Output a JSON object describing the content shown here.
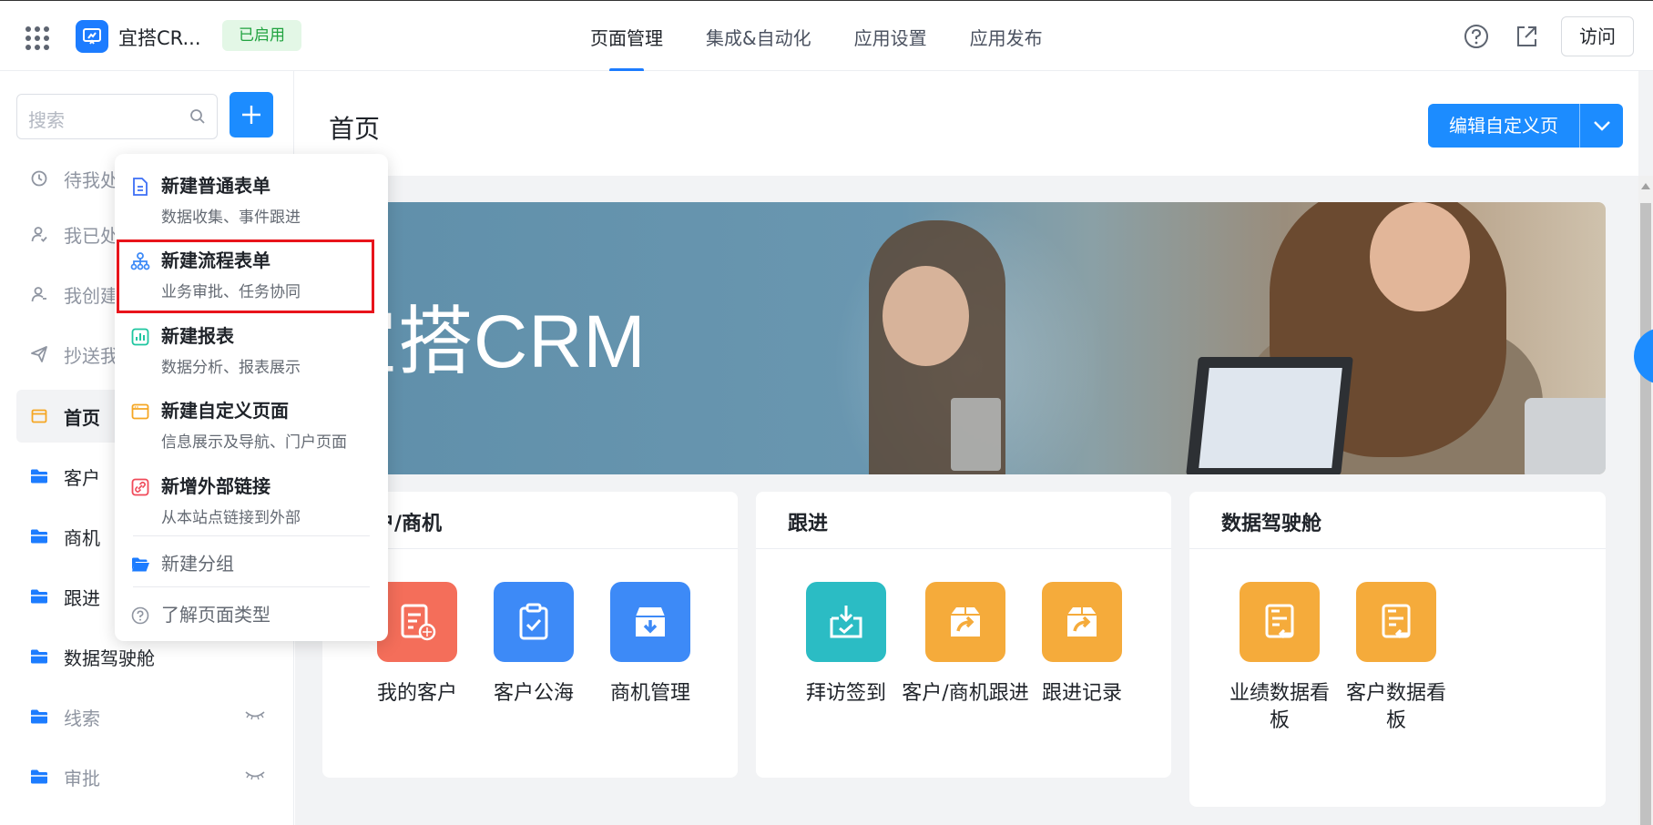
{
  "topbar": {
    "app_name": "宜搭CR...",
    "status": "已启用",
    "tabs": [
      {
        "label": "页面管理",
        "active": true
      },
      {
        "label": "集成&自动化",
        "active": false
      },
      {
        "label": "应用设置",
        "active": false
      },
      {
        "label": "应用发布",
        "active": false
      }
    ],
    "visit_label": "访问",
    "icons": [
      "apps-grid-icon",
      "help-icon",
      "external-link-icon"
    ]
  },
  "sidebar": {
    "search_placeholder": "搜索",
    "items": [
      {
        "label": "待我处理",
        "icon": "clock-icon"
      },
      {
        "label": "我已处理",
        "icon": "user-check-icon"
      },
      {
        "label": "我创建的",
        "icon": "user-icon"
      },
      {
        "label": "抄送我的",
        "icon": "send-icon"
      },
      {
        "label": "首页",
        "icon": "page-icon",
        "active": true
      },
      {
        "label": "客户",
        "icon": "folder-icon"
      },
      {
        "label": "商机",
        "icon": "folder-icon"
      },
      {
        "label": "跟进",
        "icon": "folder-icon"
      },
      {
        "label": "数据驾驶舱",
        "icon": "folder-icon"
      },
      {
        "label": "线索",
        "icon": "folder-icon",
        "hidden": true
      },
      {
        "label": "审批",
        "icon": "folder-icon",
        "hidden": true
      }
    ]
  },
  "popup_menu": {
    "items": [
      {
        "title": "新建普通表单",
        "desc": "数据收集、事件跟进",
        "icon": "form-icon"
      },
      {
        "title": "新建流程表单",
        "desc": "业务审批、任务协同",
        "icon": "flow-icon",
        "highlighted": true
      },
      {
        "title": "新建报表",
        "desc": "数据分析、报表展示",
        "icon": "report-icon"
      },
      {
        "title": "新建自定义页面",
        "desc": "信息展示及导航、门户页面",
        "icon": "custom-page-icon"
      },
      {
        "title": "新增外部链接",
        "desc": "从本站点链接到外部",
        "icon": "external-link-icon"
      }
    ],
    "new_group": "新建分组",
    "learn_types": "了解页面类型"
  },
  "main": {
    "page_title": "首页",
    "edit_button": "编辑自定义页",
    "banner_title": "宜搭CRM",
    "cards": [
      {
        "title": "客户/商机",
        "tiles": [
          {
            "label": "我的客户",
            "color": "#f46e5a"
          },
          {
            "label": "客户公海",
            "color": "#3d8af7"
          },
          {
            "label": "商机管理",
            "color": "#3d8af7"
          }
        ]
      },
      {
        "title": "跟进",
        "tiles": [
          {
            "label": "拜访签到",
            "color": "#2bbcc4"
          },
          {
            "label": "客户/商机跟进",
            "color": "#f5ab3b"
          },
          {
            "label": "跟进记录",
            "color": "#f5ab3b"
          }
        ]
      },
      {
        "title": "数据驾驶舱",
        "tiles": [
          {
            "label": "业绩数据看板",
            "color": "#f5ab3b"
          },
          {
            "label": "客户数据看板",
            "color": "#f5ab3b"
          }
        ]
      }
    ]
  }
}
